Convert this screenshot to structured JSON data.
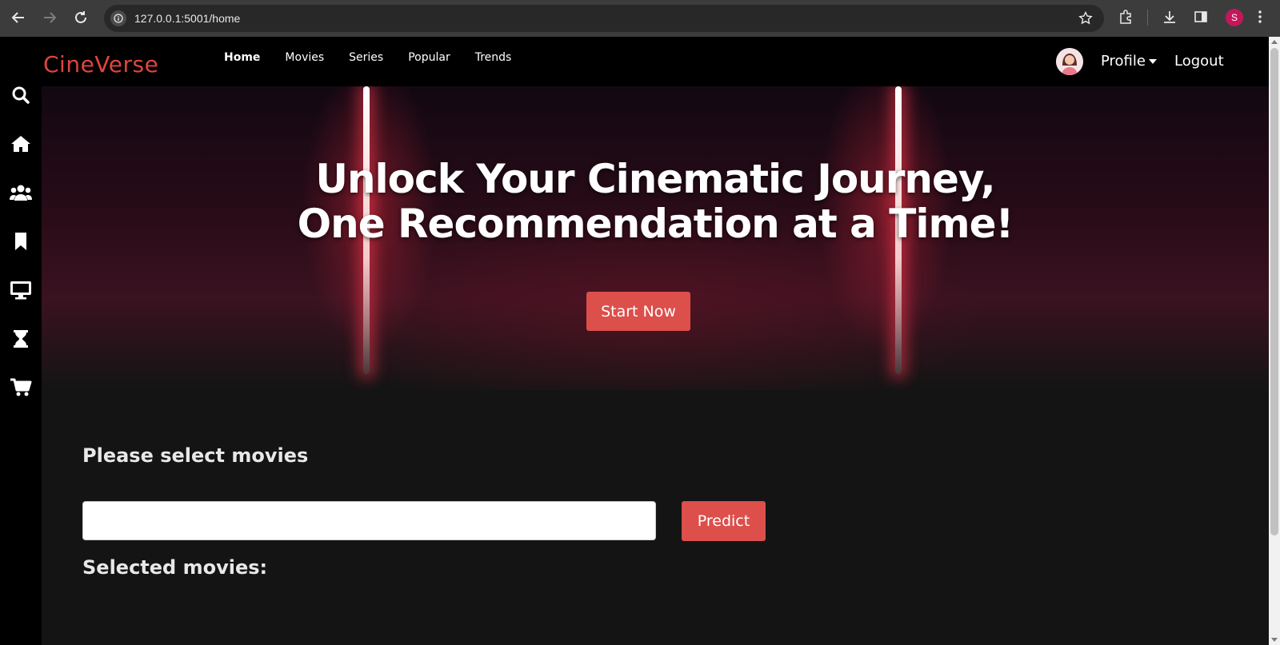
{
  "browser": {
    "url": "127.0.0.1:5001/home",
    "profile_initial": "S"
  },
  "topbar": {
    "brand": "CineVerse",
    "menu": [
      {
        "label": "Home",
        "active": true
      },
      {
        "label": "Movies"
      },
      {
        "label": "Series"
      },
      {
        "label": "Popular"
      },
      {
        "label": "Trends"
      }
    ],
    "profile_label": "Profile",
    "logout_label": "Logout"
  },
  "sidebar": {
    "icons": [
      "search-icon",
      "home-icon",
      "users-icon",
      "bookmark-icon",
      "monitor-icon",
      "hourglass-icon",
      "cart-icon"
    ]
  },
  "hero": {
    "title_line1": "Unlock Your Cinematic Journey,",
    "title_line2": "One Recommendation at a Time!",
    "cta_label": "Start Now"
  },
  "main": {
    "select_heading": "Please select movies",
    "input_value": "",
    "predict_label": "Predict",
    "selected_heading": "Selected movies:"
  },
  "colors": {
    "accent": "#dc4f4b",
    "brand": "#e0443e",
    "background": "#141414"
  }
}
